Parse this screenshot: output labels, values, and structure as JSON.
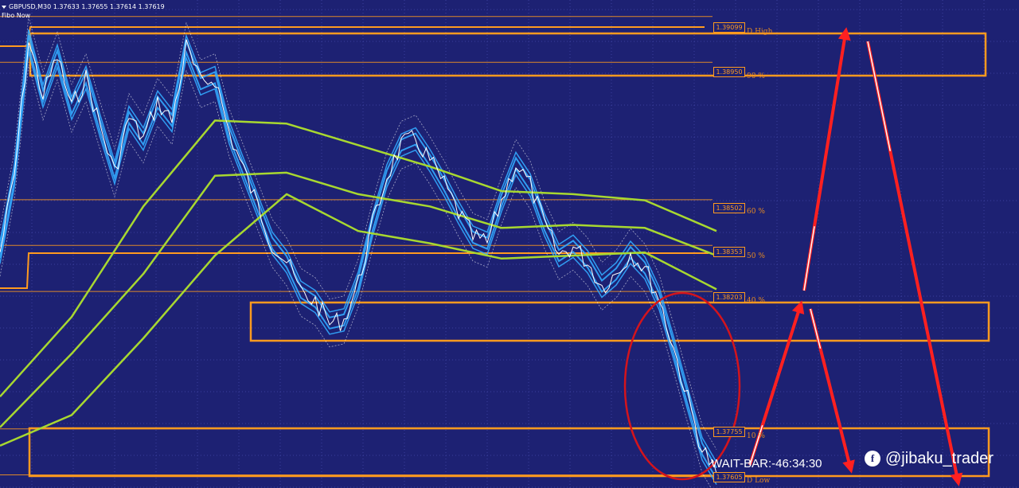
{
  "header": {
    "symbol_line": "GBPUSD,M30  1.37633 1.37655 1.37614 1.37619",
    "indicator_name": "Fibo Now"
  },
  "fibo_levels": [
    {
      "price": "1.39099",
      "label": "D High"
    },
    {
      "price": "1.38950",
      "label": "90 %"
    },
    {
      "price": "1.38502",
      "label": "60 %"
    },
    {
      "price": "1.38353",
      "label": "50 %"
    },
    {
      "price": "1.38203",
      "label": "40 %"
    },
    {
      "price": "1.37755",
      "label": "10 %"
    },
    {
      "price": "1.37605",
      "label": "D Low"
    }
  ],
  "wait_bar": "WAIT-BAR:-46:34:30",
  "watermark": "@jibaku_trader",
  "colors": {
    "background": "#1d2173",
    "grid": "#3a3f9e",
    "fibo_orange": "#ff9a1f",
    "price": "#ffffff",
    "bands": "#33aaff",
    "moving_averages": "#a8d830",
    "annotation_arrows": "#ff2020",
    "annotation_circle": "#d4141c"
  },
  "chart_data": {
    "type": "line",
    "title": "GBPUSD,M30",
    "ylim": [
      1.3757,
      1.3914
    ],
    "price_axis_ticks": [
      "1.39099",
      "1.38950",
      "1.38502",
      "1.38353",
      "1.38203",
      "1.37755",
      "1.37605"
    ],
    "price_path": [
      [
        0.0,
        1.3833
      ],
      [
        0.02,
        1.3858
      ],
      [
        0.04,
        1.3902
      ],
      [
        0.06,
        1.3884
      ],
      [
        0.08,
        1.3897
      ],
      [
        0.1,
        1.388
      ],
      [
        0.12,
        1.389
      ],
      [
        0.14,
        1.3874
      ],
      [
        0.16,
        1.3859
      ],
      [
        0.18,
        1.3877
      ],
      [
        0.2,
        1.387
      ],
      [
        0.22,
        1.3882
      ],
      [
        0.24,
        1.3876
      ],
      [
        0.26,
        1.39
      ],
      [
        0.28,
        1.3888
      ],
      [
        0.3,
        1.389
      ],
      [
        0.32,
        1.3872
      ],
      [
        0.34,
        1.386
      ],
      [
        0.36,
        1.3848
      ],
      [
        0.38,
        1.3836
      ],
      [
        0.4,
        1.383
      ],
      [
        0.42,
        1.382
      ],
      [
        0.44,
        1.3817
      ],
      [
        0.46,
        1.381
      ],
      [
        0.48,
        1.3811
      ],
      [
        0.5,
        1.3823
      ],
      [
        0.52,
        1.3842
      ],
      [
        0.54,
        1.3858
      ],
      [
        0.56,
        1.3868
      ],
      [
        0.58,
        1.387
      ],
      [
        0.6,
        1.3863
      ],
      [
        0.62,
        1.3855
      ],
      [
        0.64,
        1.3846
      ],
      [
        0.66,
        1.3838
      ],
      [
        0.68,
        1.3836
      ],
      [
        0.7,
        1.385
      ],
      [
        0.72,
        1.3862
      ],
      [
        0.74,
        1.3855
      ],
      [
        0.76,
        1.3842
      ],
      [
        0.78,
        1.3832
      ],
      [
        0.8,
        1.3835
      ],
      [
        0.82,
        1.383
      ],
      [
        0.84,
        1.3822
      ],
      [
        0.86,
        1.3826
      ],
      [
        0.88,
        1.3833
      ],
      [
        0.9,
        1.3828
      ],
      [
        0.92,
        1.3818
      ],
      [
        0.94,
        1.3802
      ],
      [
        0.96,
        1.3785
      ],
      [
        0.98,
        1.3769
      ],
      [
        1.0,
        1.3761
      ]
    ],
    "moving_averages": [
      {
        "values": [
          [
            0,
            1.3786
          ],
          [
            0.1,
            1.3812
          ],
          [
            0.2,
            1.3848
          ],
          [
            0.3,
            1.3876
          ],
          [
            0.4,
            1.3875
          ],
          [
            0.5,
            1.3868
          ],
          [
            0.6,
            1.3861
          ],
          [
            0.7,
            1.3853
          ],
          [
            0.8,
            1.3852
          ],
          [
            0.9,
            1.385
          ],
          [
            1.0,
            1.384
          ]
        ]
      },
      {
        "values": [
          [
            0,
            1.3776
          ],
          [
            0.1,
            1.38
          ],
          [
            0.2,
            1.3826
          ],
          [
            0.3,
            1.3858
          ],
          [
            0.4,
            1.3859
          ],
          [
            0.5,
            1.3852
          ],
          [
            0.6,
            1.3848
          ],
          [
            0.7,
            1.3841
          ],
          [
            0.8,
            1.3842
          ],
          [
            0.9,
            1.3841
          ],
          [
            1.0,
            1.3832
          ]
        ]
      },
      {
        "values": [
          [
            0,
            1.377
          ],
          [
            0.1,
            1.378
          ],
          [
            0.2,
            1.3805
          ],
          [
            0.3,
            1.3832
          ],
          [
            0.4,
            1.3852
          ],
          [
            0.5,
            1.384
          ],
          [
            0.6,
            1.3836
          ],
          [
            0.7,
            1.3831
          ],
          [
            0.8,
            1.3832
          ],
          [
            0.9,
            1.3833
          ],
          [
            1.0,
            1.3821
          ]
        ]
      }
    ],
    "zones": [
      {
        "from": 1.3895,
        "to": 1.3909
      },
      {
        "from": 1.3818,
        "to": 1.3823
      },
      {
        "from": 1.3764,
        "to": 1.3775
      }
    ],
    "annotations": {
      "circle": "around recent decline",
      "arrows": [
        "up",
        "down",
        "up",
        "down"
      ]
    }
  }
}
